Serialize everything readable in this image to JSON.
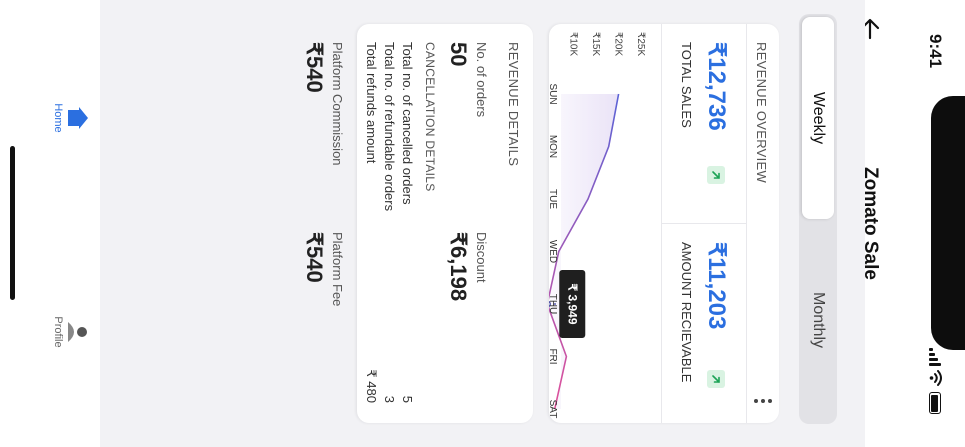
{
  "status_bar": {
    "time": "9:41"
  },
  "header": {
    "title": "Zomato Sale"
  },
  "toggle": {
    "weekly": "Weekly",
    "monthly": "Monthly"
  },
  "overview": {
    "title": "REVENUE OVERVIEW",
    "total_sales": {
      "value": "₹12,736",
      "label": "TOTAL SALES"
    },
    "amount_receivable": {
      "value": "₹11,203",
      "label": "AMOUNT RECIEVABLE"
    },
    "tooltip": "₹ 3,949"
  },
  "chart_data": {
    "type": "area",
    "x": [
      "SUN",
      "MON",
      "TUE",
      "WED",
      "THU",
      "FRI",
      "SAT"
    ],
    "y_ticks": [
      "₹10K",
      "₹15K",
      "₹20K",
      "₹25K"
    ],
    "ylim": [
      7000,
      27000
    ],
    "values": [
      19800,
      17600,
      13000,
      6500,
      3949,
      8200,
      5600
    ],
    "highlight_index": 4,
    "colors": {
      "start": "#5b63d6",
      "end": "#e0509a",
      "fill": "#d9ccf0"
    }
  },
  "details": {
    "title": "REVENUE DETAILS",
    "orders": {
      "label": "No. of orders",
      "value": "50"
    },
    "discount": {
      "label": "Discount",
      "value": "₹6,198"
    },
    "cancellation": {
      "title": "CANCELLATION DETAILS",
      "rows": [
        {
          "label": "Total no. of cancelled orders",
          "value": "5"
        },
        {
          "label": "Total no. of refundable orders",
          "value": "3"
        },
        {
          "label": "Total refunds amount",
          "value": "₹ 480"
        }
      ]
    },
    "commission": {
      "label": "Platform Commission",
      "value": "₹540"
    },
    "fee": {
      "label": "Platform Fee",
      "value": "₹540"
    }
  },
  "nav": {
    "home": "Home",
    "profile": "Profile"
  },
  "colors": {
    "accent": "#2b6fe0",
    "trend": "#1aa355"
  }
}
